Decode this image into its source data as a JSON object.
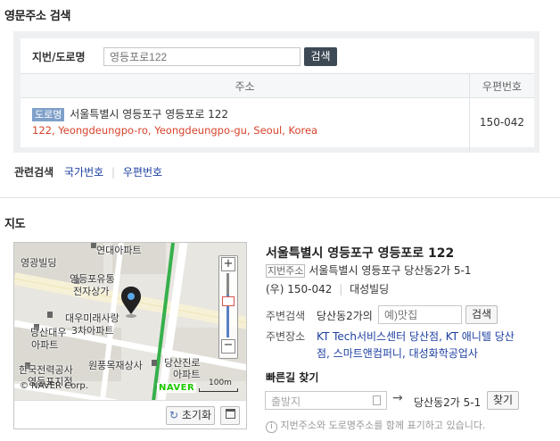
{
  "header": {
    "title": "영문주소 검색"
  },
  "search": {
    "label": "지번/도로명",
    "placeholder": "영등포로122",
    "button": "검색"
  },
  "table": {
    "col_address": "주소",
    "col_zip": "우편번호",
    "row": {
      "tag": "도로명",
      "korean": "서울특별시 영등포구 영등포로 122",
      "english": "122, Yeongdeungpo-ro, Yeongdeungpo-gu, Seoul, Korea",
      "zip": "150-042"
    }
  },
  "related": {
    "label": "관련검색",
    "links": [
      "국가번호",
      "우편번호"
    ],
    "separator": "|"
  },
  "map_section": {
    "title": "지도"
  },
  "map": {
    "labels": [
      "연대아파트",
      "영광빌딩",
      "영등포유통",
      "전자상가",
      "대우미래사랑",
      "3차아파트",
      "당산대우",
      "아파트",
      "한국전력공사",
      "영등포지점",
      "원풍목재상사",
      "당산진로",
      "아파트"
    ],
    "copyright": "© NAVER Corp.",
    "logo": "NAVER",
    "scale": "100m",
    "zoom_in": "+",
    "zoom_out": "−",
    "reset_button": "초기화"
  },
  "place": {
    "title": "서울특별시 영등포구 영등포로 122",
    "jibun_tag": "지번주소",
    "jibun": "서울특별시 영등포구 당산동2가 5-1",
    "zip": "(우) 150-042",
    "building": "대성빌딩",
    "nearby_search_label": "주변검색",
    "nearby_search_prefix": "당산동2가의",
    "nearby_search_placeholder": "예)맛집",
    "nearby_search_button": "검색",
    "nearby_places_label": "주변장소",
    "nearby_places_line1": "KT Tech서비스센터 당산점, KT 애니텔 당산",
    "nearby_places_line2": "점, 스마트앤컴퍼니, 대성화학공업사",
    "directions_title": "빠른길 찾기",
    "directions_placeholder": "출발지",
    "directions_arrow": "→",
    "directions_dest": "당산동2가 5-1",
    "directions_button": "찾기",
    "note": "지번주소와 도로명주소를 함께 표기하고 있습니다."
  },
  "colors": {
    "link": "#1d3fa0",
    "english_addr": "#d6432b",
    "tag_bg": "#7fa0c9",
    "button_dark": "#3d4a55"
  }
}
